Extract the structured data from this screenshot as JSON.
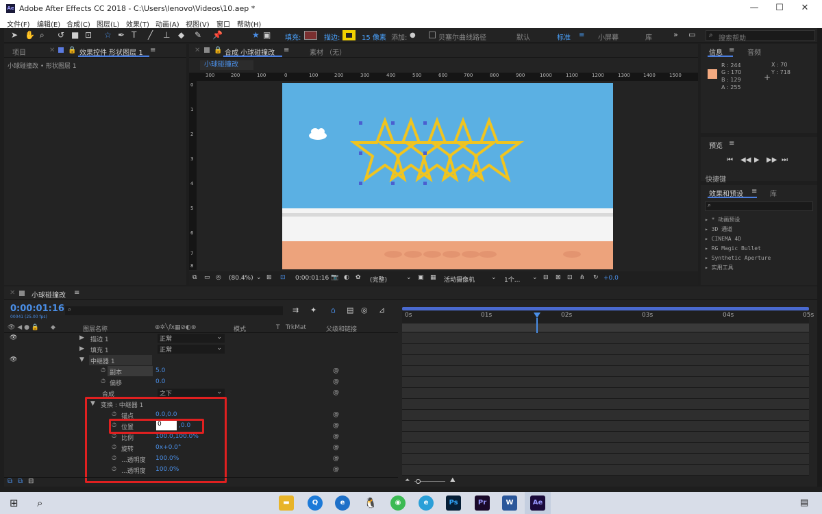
{
  "window": {
    "title": "Adobe After Effects CC 2018 - C:\\Users\\lenovo\\Videos\\10.aep *",
    "app_icon": "Ae",
    "min": "—",
    "max": "☐",
    "close": "✕"
  },
  "menu": [
    "文件(F)",
    "编辑(E)",
    "合成(C)",
    "图层(L)",
    "效果(T)",
    "动画(A)",
    "视图(V)",
    "窗口",
    "帮助(H)"
  ],
  "toolbar": {
    "fill_label": "填充:",
    "stroke_label": "描边:",
    "stroke_px": "15 像素",
    "add_label": "添加:",
    "bezier_label": "贝塞尔曲线路径",
    "workspaces": [
      "默认",
      "标准",
      "小屏幕",
      "库"
    ],
    "search_placeholder": "搜索帮助",
    "more": "»"
  },
  "left_panel": {
    "tabs": [
      "项目",
      "效果控件 形状图层 1"
    ],
    "breadcrumb": "小球碰撞改 • 形状图层 1"
  },
  "comp_panel": {
    "tabs": [
      "合成 小球碰撞改",
      "素材 （无）"
    ],
    "comp_tab": "小球碰撞改",
    "ruler": [
      "300",
      "200",
      "100",
      "0",
      "100",
      "200",
      "300",
      "400",
      "500",
      "600",
      "700",
      "800",
      "900",
      "1000",
      "1100",
      "1200",
      "1300",
      "1400",
      "1500"
    ],
    "vruler": [
      "0",
      "1",
      "2",
      "3",
      "4",
      "5",
      "6",
      "7",
      "8"
    ],
    "footer": {
      "zoom": "(80.4%)",
      "time": "0:00:01:16",
      "quality": "(完整)",
      "camera": "活动摄像机",
      "views": "1个...",
      "exposure": "+0.0"
    }
  },
  "info_panel": {
    "title": "信息",
    "audio_tab": "音频",
    "swatch": "#f4aa81",
    "r": "R : 244",
    "g": "G : 170",
    "b": "B : 129",
    "a": "A : 255",
    "x": "X : 70",
    "y": "Y : 718"
  },
  "preview_panel": {
    "title": "预览",
    "shortcut_label": "快捷键"
  },
  "effects_panel": {
    "title": "效果和预设",
    "lib_tab": "库",
    "items": [
      "* 动画预设",
      "3D 通道",
      "CINEMA 4D",
      "RG Magic Bullet",
      "Synthetic Aperture",
      "实用工具"
    ]
  },
  "timeline": {
    "tab": "小球碰撞改",
    "timecode": "0:00:01:16",
    "fps": "00041 (25.00 fps)",
    "columns": {
      "name": "图层名称",
      "mode": "模式",
      "t": "T",
      "trkmat": "TrkMat",
      "parent": "父级和链接"
    },
    "ruler": [
      "0s",
      "01s",
      "02s",
      "03s",
      "04s",
      "05s"
    ],
    "rows": [
      {
        "label": "描边 1",
        "value": "正常"
      },
      {
        "label": "填充 1",
        "value": "正常"
      },
      {
        "label": "中继器 1",
        "value": ""
      },
      {
        "label": "副本",
        "value": "5.0"
      },
      {
        "label": "偏移",
        "value": "0.0"
      },
      {
        "label": "合成",
        "value": "之下"
      },
      {
        "label": "变换 : 中继器 1",
        "value": ""
      },
      {
        "label": "锚点",
        "value": "0.0,0.0"
      },
      {
        "label": "位置",
        "value": "0",
        "value2": ",0.0"
      },
      {
        "label": "比例",
        "value": "100.0,100.0%"
      },
      {
        "label": "旋转",
        "value": "0x+0.0°"
      },
      {
        "label": "...透明度",
        "value": "100.0%"
      },
      {
        "label": "...透明度",
        "value": "100.0%"
      }
    ]
  },
  "colors": {
    "accent": "#4a8fe8",
    "highlight": "#e02020",
    "sky": "#5bb0e3",
    "sand": "#eda37c",
    "star": "#f0c420"
  }
}
